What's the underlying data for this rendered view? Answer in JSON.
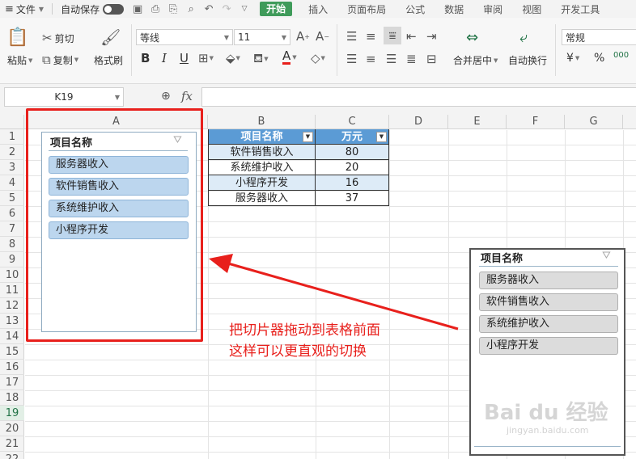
{
  "menubar": {
    "file_label": "文件",
    "autosave_label": "自动保存",
    "tabs": [
      "开始",
      "插入",
      "页面布局",
      "公式",
      "数据",
      "审阅",
      "视图",
      "开发工具"
    ]
  },
  "ribbon": {
    "paste_label": "粘贴",
    "cut_label": "剪切",
    "copy_label": "复制",
    "format_painter_label": "格式刷",
    "font_name": "等线",
    "font_size": "11",
    "bold": "B",
    "italic": "I",
    "underline": "U",
    "font_color_glyph": "A",
    "merge_center_label": "合并居中",
    "wrap_text_label": "自动换行",
    "number_format": "常规",
    "currency_glyph": "¥",
    "percent_glyph": "%",
    "thousands_glyph": "000"
  },
  "formula_bar": {
    "name_box": "K19",
    "fx_label": "fx"
  },
  "grid": {
    "columns": [
      "A",
      "B",
      "C",
      "D",
      "E",
      "F",
      "G"
    ],
    "rows": [
      "1",
      "2",
      "3",
      "4",
      "5",
      "6",
      "7",
      "8",
      "9",
      "10",
      "11",
      "12",
      "13",
      "14",
      "15",
      "16",
      "17",
      "18",
      "19",
      "20",
      "21",
      "22"
    ],
    "active_row": "19"
  },
  "table": {
    "headers": [
      "项目名称",
      "万元"
    ],
    "rows": [
      [
        "软件销售收入",
        "80"
      ],
      [
        "系统维护收入",
        "20"
      ],
      [
        "小程序开发",
        "16"
      ],
      [
        "服务器收入",
        "37"
      ]
    ]
  },
  "slicer_left": {
    "title": "项目名称",
    "items": [
      "服务器收入",
      "软件销售收入",
      "系统维护收入",
      "小程序开发"
    ]
  },
  "slicer_right": {
    "title": "项目名称",
    "items": [
      "服务器收入",
      "软件销售收入",
      "系统维护收入",
      "小程序开发"
    ]
  },
  "annotation": {
    "line1": "把切片器拖动到表格前面",
    "line2": "这样可以更直观的切换"
  },
  "watermark": {
    "logo": "Bai du 经验",
    "url": "jingyan.baidu.com"
  },
  "colors": {
    "accent_green": "#3f9b5a",
    "table_header": "#5b9bd5",
    "table_band": "#ddebf7",
    "annotation_red": "#e8201c",
    "slicer_selected": "#bcd6ee"
  }
}
